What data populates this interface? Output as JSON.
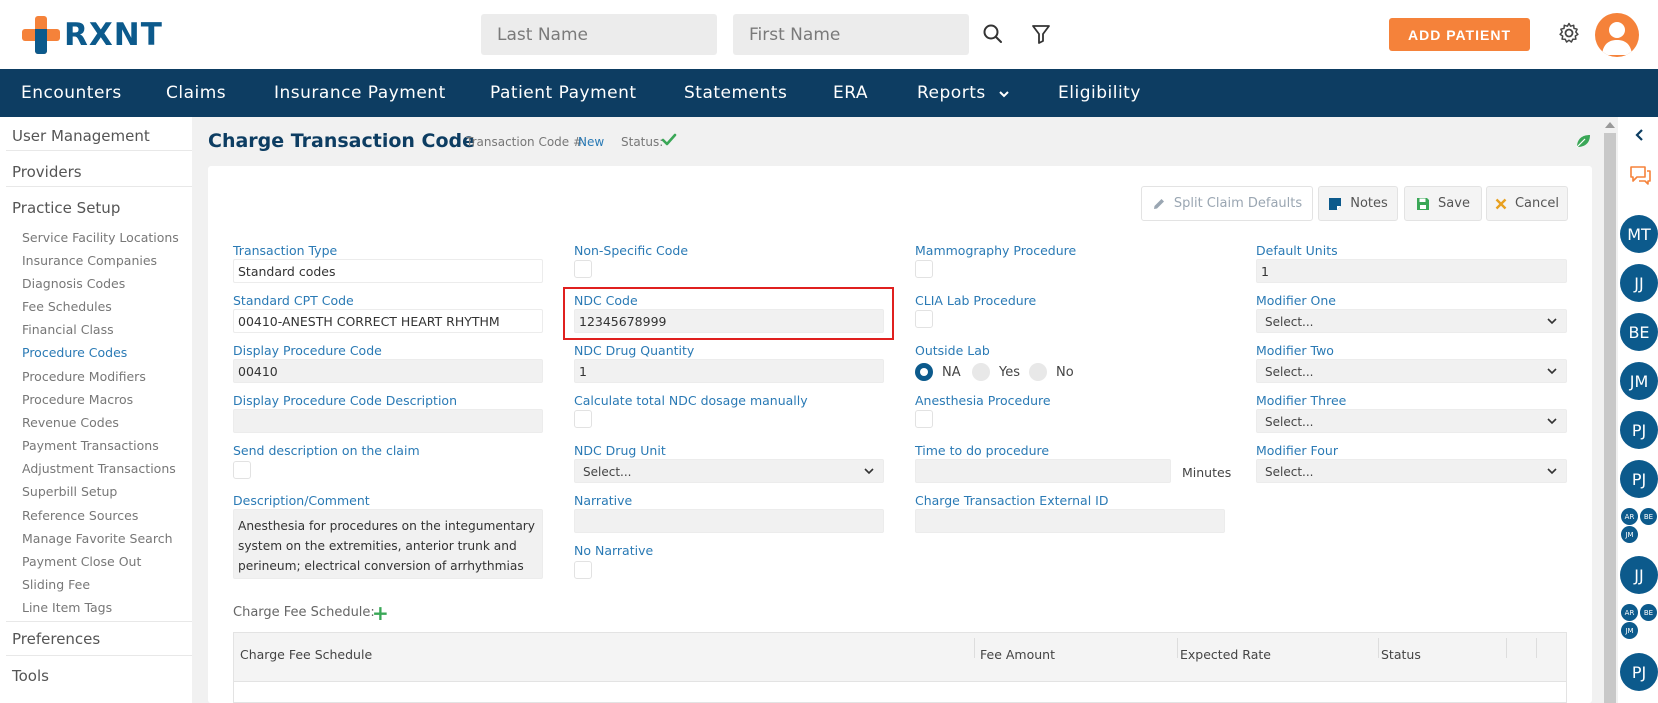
{
  "header": {
    "brand": "RXNT",
    "last_name_placeholder": "Last Name",
    "first_name_placeholder": "First Name",
    "add_patient": "ADD PATIENT"
  },
  "nav": {
    "items": [
      "Encounters",
      "Claims",
      "Insurance Payment",
      "Patient Payment",
      "Statements",
      "ERA",
      "Reports",
      "Eligibility"
    ]
  },
  "sidebar": {
    "sections": [
      "User Management",
      "Providers",
      "Practice Setup",
      "Preferences",
      "Tools"
    ],
    "items": [
      "Service Facility Locations",
      "Insurance Companies",
      "Diagnosis Codes",
      "Fee Schedules",
      "Financial Class",
      "Procedure Codes",
      "Procedure Modifiers",
      "Procedure Macros",
      "Revenue Codes",
      "Payment Transactions",
      "Adjustment Transactions",
      "Superbill Setup",
      "Reference Sources",
      "Manage Favorite Search",
      "Payment Close Out",
      "Sliding Fee",
      "Line Item Tags"
    ],
    "active_item": "Procedure Codes"
  },
  "page": {
    "title": "Charge Transaction Code",
    "transaction_code_label": "Transaction Code #:",
    "transaction_code_value": "New",
    "status_label": "Status:"
  },
  "toolbar": {
    "split": "Split Claim Defaults",
    "notes": "Notes",
    "save": "Save",
    "cancel": "Cancel"
  },
  "form": {
    "transaction_type": {
      "label": "Transaction Type",
      "value": "Standard codes"
    },
    "standard_cpt": {
      "label": "Standard CPT Code",
      "value": "00410-ANESTH CORRECT HEART RHYTHM"
    },
    "display_code": {
      "label": "Display Procedure Code",
      "value": "00410"
    },
    "display_desc": {
      "label": "Display Procedure Code Description",
      "value": ""
    },
    "send_desc": {
      "label": "Send description on the claim"
    },
    "description": {
      "label": "Description/Comment",
      "lines": [
        "Anesthesia for procedures on the integumentary",
        "system on the extremities, anterior trunk and",
        "perineum; electrical conversion of arrhythmias"
      ]
    },
    "non_specific": {
      "label": "Non-Specific Code"
    },
    "ndc_code": {
      "label": "NDC Code",
      "value": "12345678999"
    },
    "ndc_qty": {
      "label": "NDC Drug Quantity",
      "value": "1"
    },
    "calc_ndc": {
      "label": "Calculate total NDC dosage manually"
    },
    "ndc_unit": {
      "label": "NDC Drug Unit",
      "value": "Select..."
    },
    "narrative": {
      "label": "Narrative",
      "value": ""
    },
    "no_narrative": {
      "label": "No Narrative"
    },
    "mammography": {
      "label": "Mammography Procedure"
    },
    "clia": {
      "label": "CLIA Lab Procedure"
    },
    "outside_lab": {
      "label": "Outside Lab",
      "options": [
        "NA",
        "Yes",
        "No"
      ],
      "selected": "NA"
    },
    "anesthesia": {
      "label": "Anesthesia Procedure"
    },
    "time_to_do": {
      "label": "Time to do procedure",
      "unit": "Minutes"
    },
    "external_id": {
      "label": "Charge Transaction External ID"
    },
    "default_units": {
      "label": "Default Units",
      "value": "1"
    },
    "modifier_one": {
      "label": "Modifier One",
      "value": "Select..."
    },
    "modifier_two": {
      "label": "Modifier Two",
      "value": "Select..."
    },
    "modifier_three": {
      "label": "Modifier Three",
      "value": "Select..."
    },
    "modifier_four": {
      "label": "Modifier Four",
      "value": "Select..."
    }
  },
  "fee_schedule": {
    "label": "Charge Fee Schedule:",
    "columns": [
      "Charge Fee Schedule",
      "Fee Amount",
      "Expected Rate",
      "Status"
    ]
  },
  "right_rail": {
    "avatars": [
      "MT",
      "JJ",
      "BE",
      "JM",
      "PJ",
      "PJ",
      "JJ",
      "PJ"
    ],
    "mini_group": [
      "AR",
      "BE",
      "JM"
    ]
  },
  "colors": {
    "navy": "#0d3d62",
    "brand_blue": "#0c5a8c",
    "accent_orange": "#f5823a",
    "link_blue": "#2a7ab5",
    "highlight_red": "#e0201f",
    "success_green": "#3aa757"
  }
}
